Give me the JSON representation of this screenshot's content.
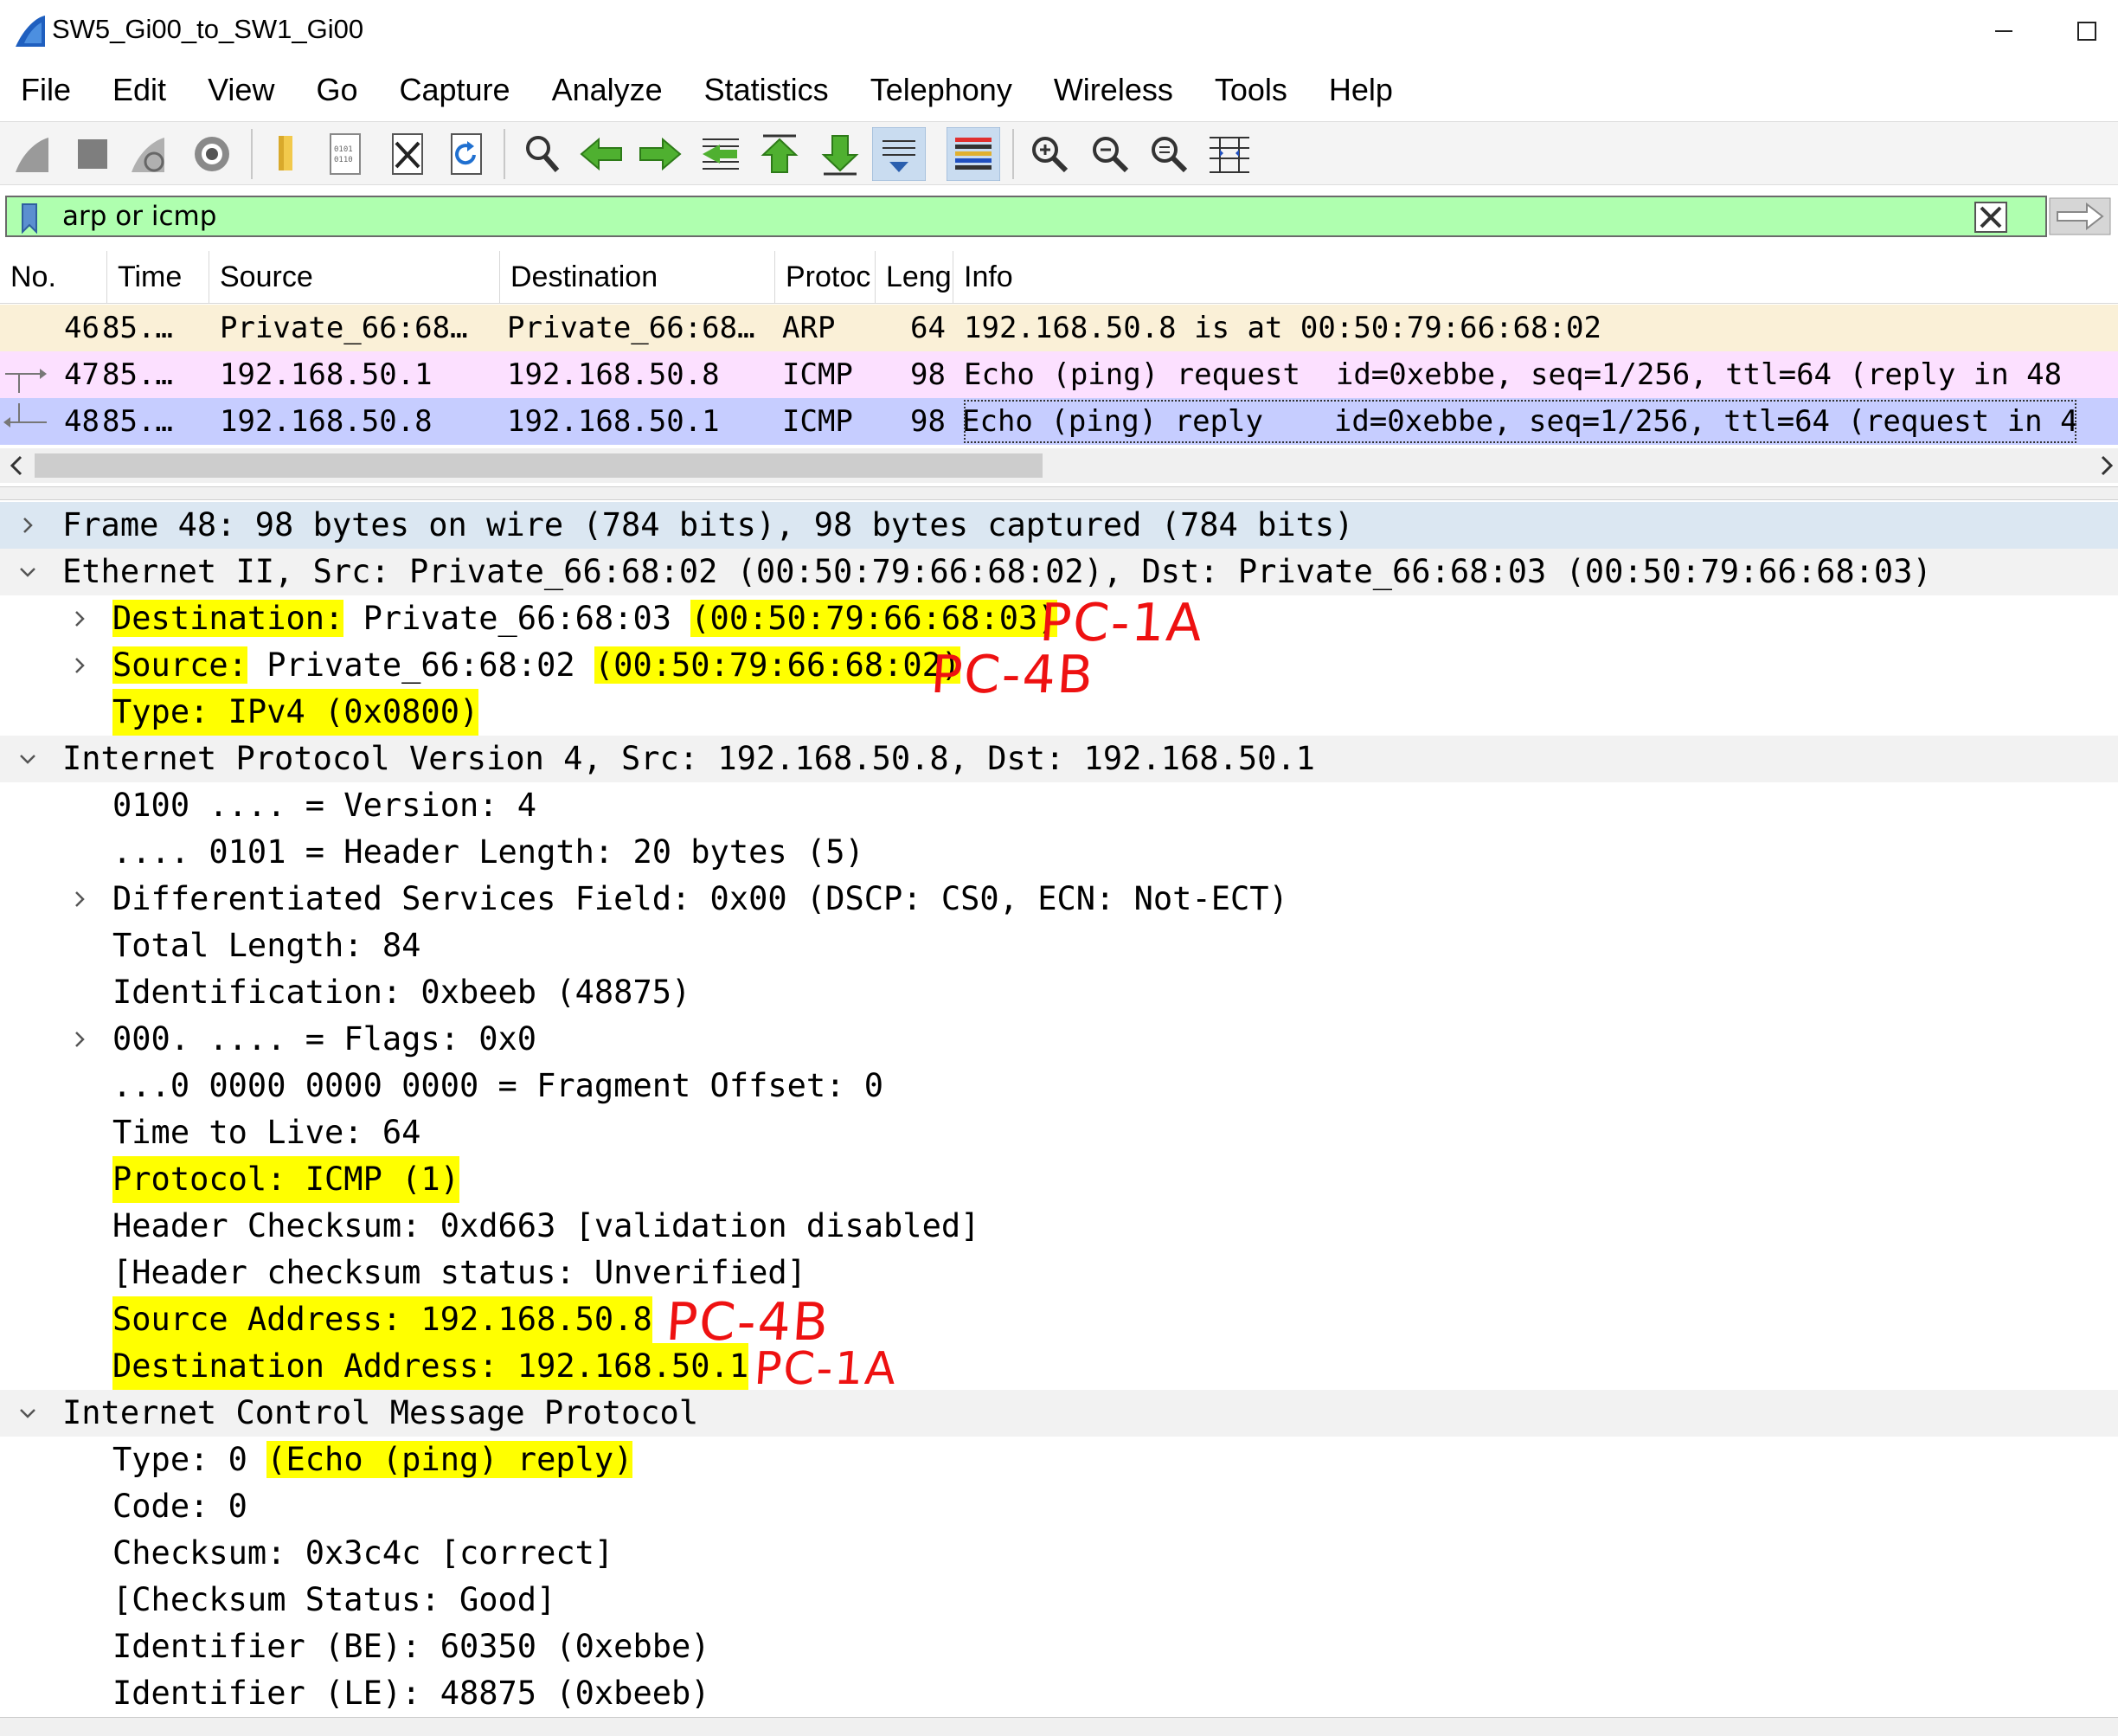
{
  "window": {
    "title": "SW5_Gi00_to_SW1_Gi00"
  },
  "menu": [
    "File",
    "Edit",
    "View",
    "Go",
    "Capture",
    "Analyze",
    "Statistics",
    "Telephony",
    "Wireless",
    "Tools",
    "Help"
  ],
  "filter": {
    "value": "arp or icmp"
  },
  "packet_list": {
    "columns": [
      "No.",
      "Time",
      "Source",
      "Destination",
      "Protoc",
      "Leng",
      "Info"
    ],
    "rows": [
      {
        "no": "46",
        "time": "85.…",
        "source": "Private_66:68…",
        "destination": "Private_66:68…",
        "protocol": "ARP",
        "length": "64",
        "info": "192.168.50.8 is at 00:50:79:66:68:02"
      },
      {
        "no": "47",
        "time": "85.…",
        "source": "192.168.50.1",
        "destination": "192.168.50.8",
        "protocol": "ICMP",
        "length": "98",
        "info": "Echo (ping) request  id=0xebbe, seq=1/256, ttl=64 (reply in 48"
      },
      {
        "no": "48",
        "time": "85.…",
        "source": "192.168.50.8",
        "destination": "192.168.50.1",
        "protocol": "ICMP",
        "length": "98",
        "info": "Echo (ping) reply    id=0xebbe, seq=1/256, ttl=64 (request in 4"
      }
    ]
  },
  "details": {
    "frame": "Frame 48: 98 bytes on wire (784 bits), 98 bytes captured (784 bits)",
    "ethernet": {
      "header": "Ethernet II, Src: Private_66:68:02 (00:50:79:66:68:02), Dst: Private_66:68:03 (00:50:79:66:68:03)",
      "dst_label": "Destination:",
      "dst_name": " Private_66:68:03 ",
      "dst_mac": "(00:50:79:66:68:03)",
      "src_label": "Source:",
      "src_name": " Private_66:68:02 ",
      "src_mac": "(00:50:79:66:68:02)",
      "type": "Type: IPv4 (0x0800)"
    },
    "ip": {
      "header": "Internet Protocol Version 4, Src: 192.168.50.8, Dst: 192.168.50.1",
      "version": "0100 .... = Version: 4",
      "header_length": ".... 0101 = Header Length: 20 bytes (5)",
      "dsf": "Differentiated Services Field: 0x00 (DSCP: CS0, ECN: Not-ECT)",
      "total_length": "Total Length: 84",
      "identification": "Identification: 0xbeeb (48875)",
      "flags": "000. .... = Flags: 0x0",
      "fragment_offset": "...0 0000 0000 0000 = Fragment Offset: 0",
      "ttl": "Time to Live: 64",
      "protocol": "Protocol: ICMP (1)",
      "checksum": "Header Checksum: 0xd663 [validation disabled]",
      "checksum_status": "[Header checksum status: Unverified]",
      "src_addr": "Source Address: 192.168.50.8",
      "dst_addr": "Destination Address: 192.168.50.1"
    },
    "icmp": {
      "header": "Internet Control Message Protocol",
      "type_prefix": "Type: 0 ",
      "type_desc": "(Echo (ping) reply)",
      "code": "Code: 0",
      "checksum": "Checksum: 0x3c4c [correct]",
      "checksum_status": "[Checksum Status: Good]",
      "id_be": "Identifier (BE): 60350 (0xebbe)",
      "id_le": "Identifier (LE): 48875 (0xbeeb)"
    }
  },
  "annotations": {
    "eth_dst": "PC-1A",
    "eth_src": "PC-4B",
    "ip_src": "PC-4B",
    "ip_dst": "PC-1A"
  },
  "colors": {
    "filter_valid": "#afffaf",
    "highlight": "#ffff00",
    "annotation": "#ee1111",
    "row_arp": "#faf0d7",
    "row_icmp_request": "#fce0ff",
    "row_icmp_reply_selected": "#c6cdff"
  }
}
